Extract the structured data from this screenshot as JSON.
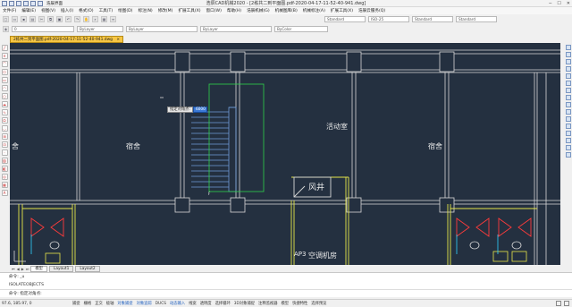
{
  "window": {
    "title": "浩辰CAD机械2020 - [2栋共二到平面图.pdf-2020-04-17-11-52-40-941.dwg]",
    "quickbar_label": "浩辰界面"
  },
  "menu": [
    "文件(F)",
    "编辑(E)",
    "视图(V)",
    "插入(I)",
    "格式(O)",
    "工具(T)",
    "绘图(D)",
    "标注(N)",
    "修改(M)",
    "扩展工具(X)",
    "窗口(W)",
    "帮助(H)",
    "浩辰机械(G)",
    "机械图库(B)",
    "机械标注(A)",
    "扩展工具(X)",
    "浩辰云服务(Q)"
  ],
  "toolbar": {
    "style_combos": [
      "Standard",
      "ISO-25",
      "Standard",
      "Standard"
    ],
    "layer_combo": "0",
    "color_combo": "ByLayer",
    "linetype_combo": "ByLayer",
    "lineweight_combo": "ByLayer",
    "plot_combo": "ByColor"
  },
  "document": {
    "tab_label": "2栋共二到平面图.pdf-2020-04-17-11-52-40-941.dwg"
  },
  "drawing": {
    "rooms": [
      "宿舍",
      "宿舍",
      "活动室",
      "宿舍",
      "风井",
      "空调机房"
    ],
    "tooltip_prompt": "指定对角点:",
    "tooltip_value": "6000",
    "edge_labels": [
      "舍",
      "AP3",
      "F"
    ]
  },
  "layout_tabs": [
    "模型",
    "Layout1",
    "Layout2"
  ],
  "command": {
    "history": [
      "命令: _u",
      "ISOLATEOBJECTS"
    ],
    "prompt": "命令: 指定对角点:"
  },
  "status": {
    "coords": "97.6, 185.97, 0",
    "buttons": [
      "捕捉",
      "栅格",
      "正交",
      "极轴",
      "对象捕捉",
      "对象追踪",
      "DUCS",
      "动态输入",
      "线宽",
      "透明度",
      "选择循环",
      "3D对象捕捉",
      "注释监视器",
      "模型",
      "快捷特性",
      "选择预览"
    ]
  }
}
